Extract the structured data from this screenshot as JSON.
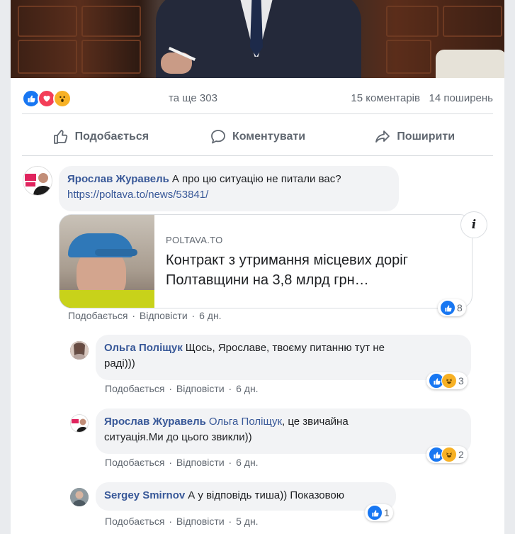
{
  "post": {
    "reactions_other_text": "та ще 303",
    "comments_count_text": "15 коментарів",
    "shares_count_text": "14 поширень",
    "reaction_icons": [
      "like-icon",
      "love-icon",
      "wow-icon"
    ]
  },
  "actions": {
    "like_label": "Подобається",
    "comment_label": "Коментувати",
    "share_label": "Поширити"
  },
  "comments": [
    {
      "author": "Ярослав Журавель",
      "text": "А про цю ситуацію не питали вас?",
      "link": "https://poltava.to/news/53841/",
      "preview": {
        "domain": "POLTAVA.TO",
        "title": "Контракт з утримання місцевих доріг Полтавщини на 3,8 млрд грн…",
        "info_glyph": "i"
      },
      "like_label": "Подобається",
      "reply_label": "Відповісти",
      "time": "6 дн.",
      "reaction_count": "8"
    }
  ],
  "replies": [
    {
      "author": "Ольга Поліщук",
      "text_line1": "Щось, Ярославе, твоєму питанню тут не",
      "text_line2": "раді)))",
      "like_label": "Подобається",
      "reply_label": "Відповісти",
      "time": "6 дн.",
      "reaction_count": "3"
    },
    {
      "author": "Ярослав Журавель",
      "mention": "Ольга Поліщук",
      "text_line1": ", це звичайна",
      "text_line2": "ситуація.Ми до цього звикли))",
      "like_label": "Подобається",
      "reply_label": "Відповісти",
      "time": "6 дн.",
      "reaction_count": "2"
    },
    {
      "author": "Sergey Smirnov",
      "text_line1": "А у відповідь тиша)) Показовою",
      "like_label": "Подобається",
      "reply_label": "Відповісти",
      "time": "5 дн.",
      "reaction_count": "1"
    }
  ],
  "meta_separator": "·",
  "colors": {
    "author_link": "#385898",
    "like_blue": "#1877f2",
    "love_red": "#f33e58",
    "haha_yellow": "#f7b125",
    "bubble_bg": "#f2f3f5",
    "muted_text": "#606770"
  }
}
